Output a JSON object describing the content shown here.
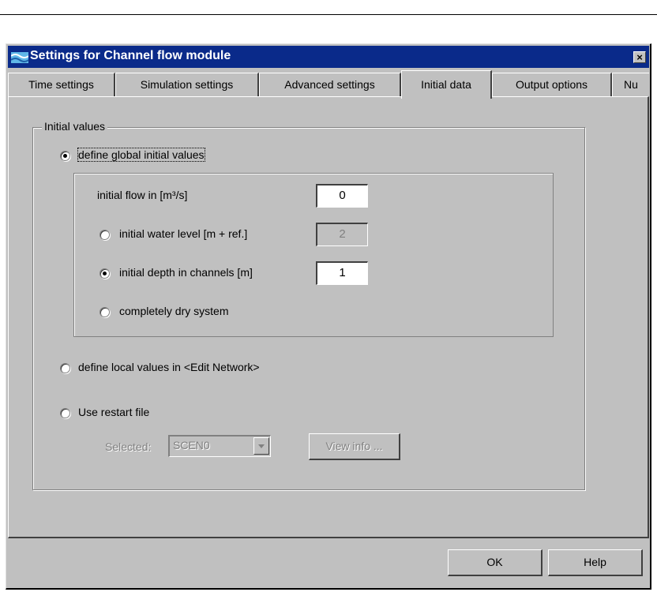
{
  "window": {
    "title": "Settings for Channel flow module",
    "close_label": "×",
    "app_icon": "module-icon"
  },
  "tabs": [
    {
      "label": "Time settings",
      "active": false
    },
    {
      "label": "Simulation settings",
      "active": false
    },
    {
      "label": "Advanced settings",
      "active": false
    },
    {
      "label": "Initial data",
      "active": true
    },
    {
      "label": "Output options",
      "active": false
    },
    {
      "label": "Nu",
      "active": false
    }
  ],
  "initial_values": {
    "group_label": "Initial values",
    "global_option": {
      "label": "define global initial values",
      "checked": true
    },
    "flow": {
      "label": "initial flow in [m³/s]",
      "value": "0"
    },
    "water_level": {
      "label": "initial water level [m + ref.]",
      "value": "2",
      "checked": false
    },
    "depth": {
      "label": "initial depth in channels [m]",
      "value": "1",
      "checked": true
    },
    "dry": {
      "label": "completely dry system",
      "checked": false
    },
    "local_option": {
      "label": "define local values in <Edit Network>",
      "checked": false
    },
    "restart_option": {
      "label": "Use restart file",
      "checked": false
    },
    "selected_label": "Selected:",
    "selected_value": "SCEN0",
    "view_info_label": "View info ..."
  },
  "footer": {
    "ok_label": "OK",
    "help_label": "Help"
  },
  "colors": {
    "title_bar": "#0a2a8a",
    "face": "#c0c0c0"
  }
}
